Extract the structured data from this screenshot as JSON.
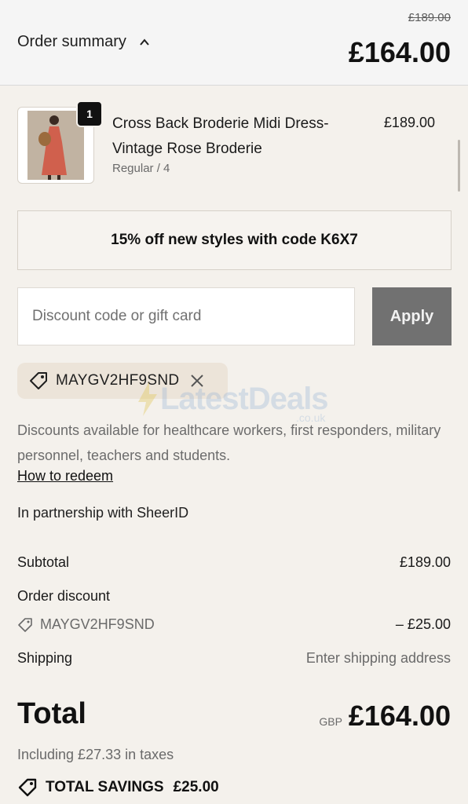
{
  "header": {
    "summary_label": "Order summary",
    "original_price": "£189.00",
    "total": "£164.00"
  },
  "product": {
    "quantity": "1",
    "name": "Cross Back Broderie Midi Dress- Vintage Rose Broderie",
    "variant": "Regular / 4",
    "price": "£189.00",
    "image_icon": "dress-photo"
  },
  "promo_banner": {
    "text": "15% off new styles with code K6X7"
  },
  "discount": {
    "placeholder": "Discount code or gift card",
    "value": "",
    "apply_label": "Apply",
    "applied_code": "MAYGV2HF9SND"
  },
  "watermark": {
    "text": "LatestDeals",
    "sub": ".co.uk"
  },
  "info": {
    "text": "Discounts available for healthcare workers, first responders, military personnel, teachers and students.",
    "link_label": "How to redeem",
    "partner": "In partnership with SheerID"
  },
  "totals": {
    "subtotal_label": "Subtotal",
    "subtotal_value": "£189.00",
    "discount_label": "Order discount",
    "discount_code": "MAYGV2HF9SND",
    "discount_value": "– £25.00",
    "shipping_label": "Shipping",
    "shipping_value": "Enter shipping address",
    "total_label": "Total",
    "currency": "GBP",
    "total_value": "£164.00",
    "taxes": "Including £27.33 in taxes",
    "savings_label": "TOTAL SAVINGS",
    "savings_value": "£25.00"
  },
  "colors": {
    "background": "#f4f1ec",
    "apply_button": "#717171",
    "chip": "#ece4d9"
  }
}
